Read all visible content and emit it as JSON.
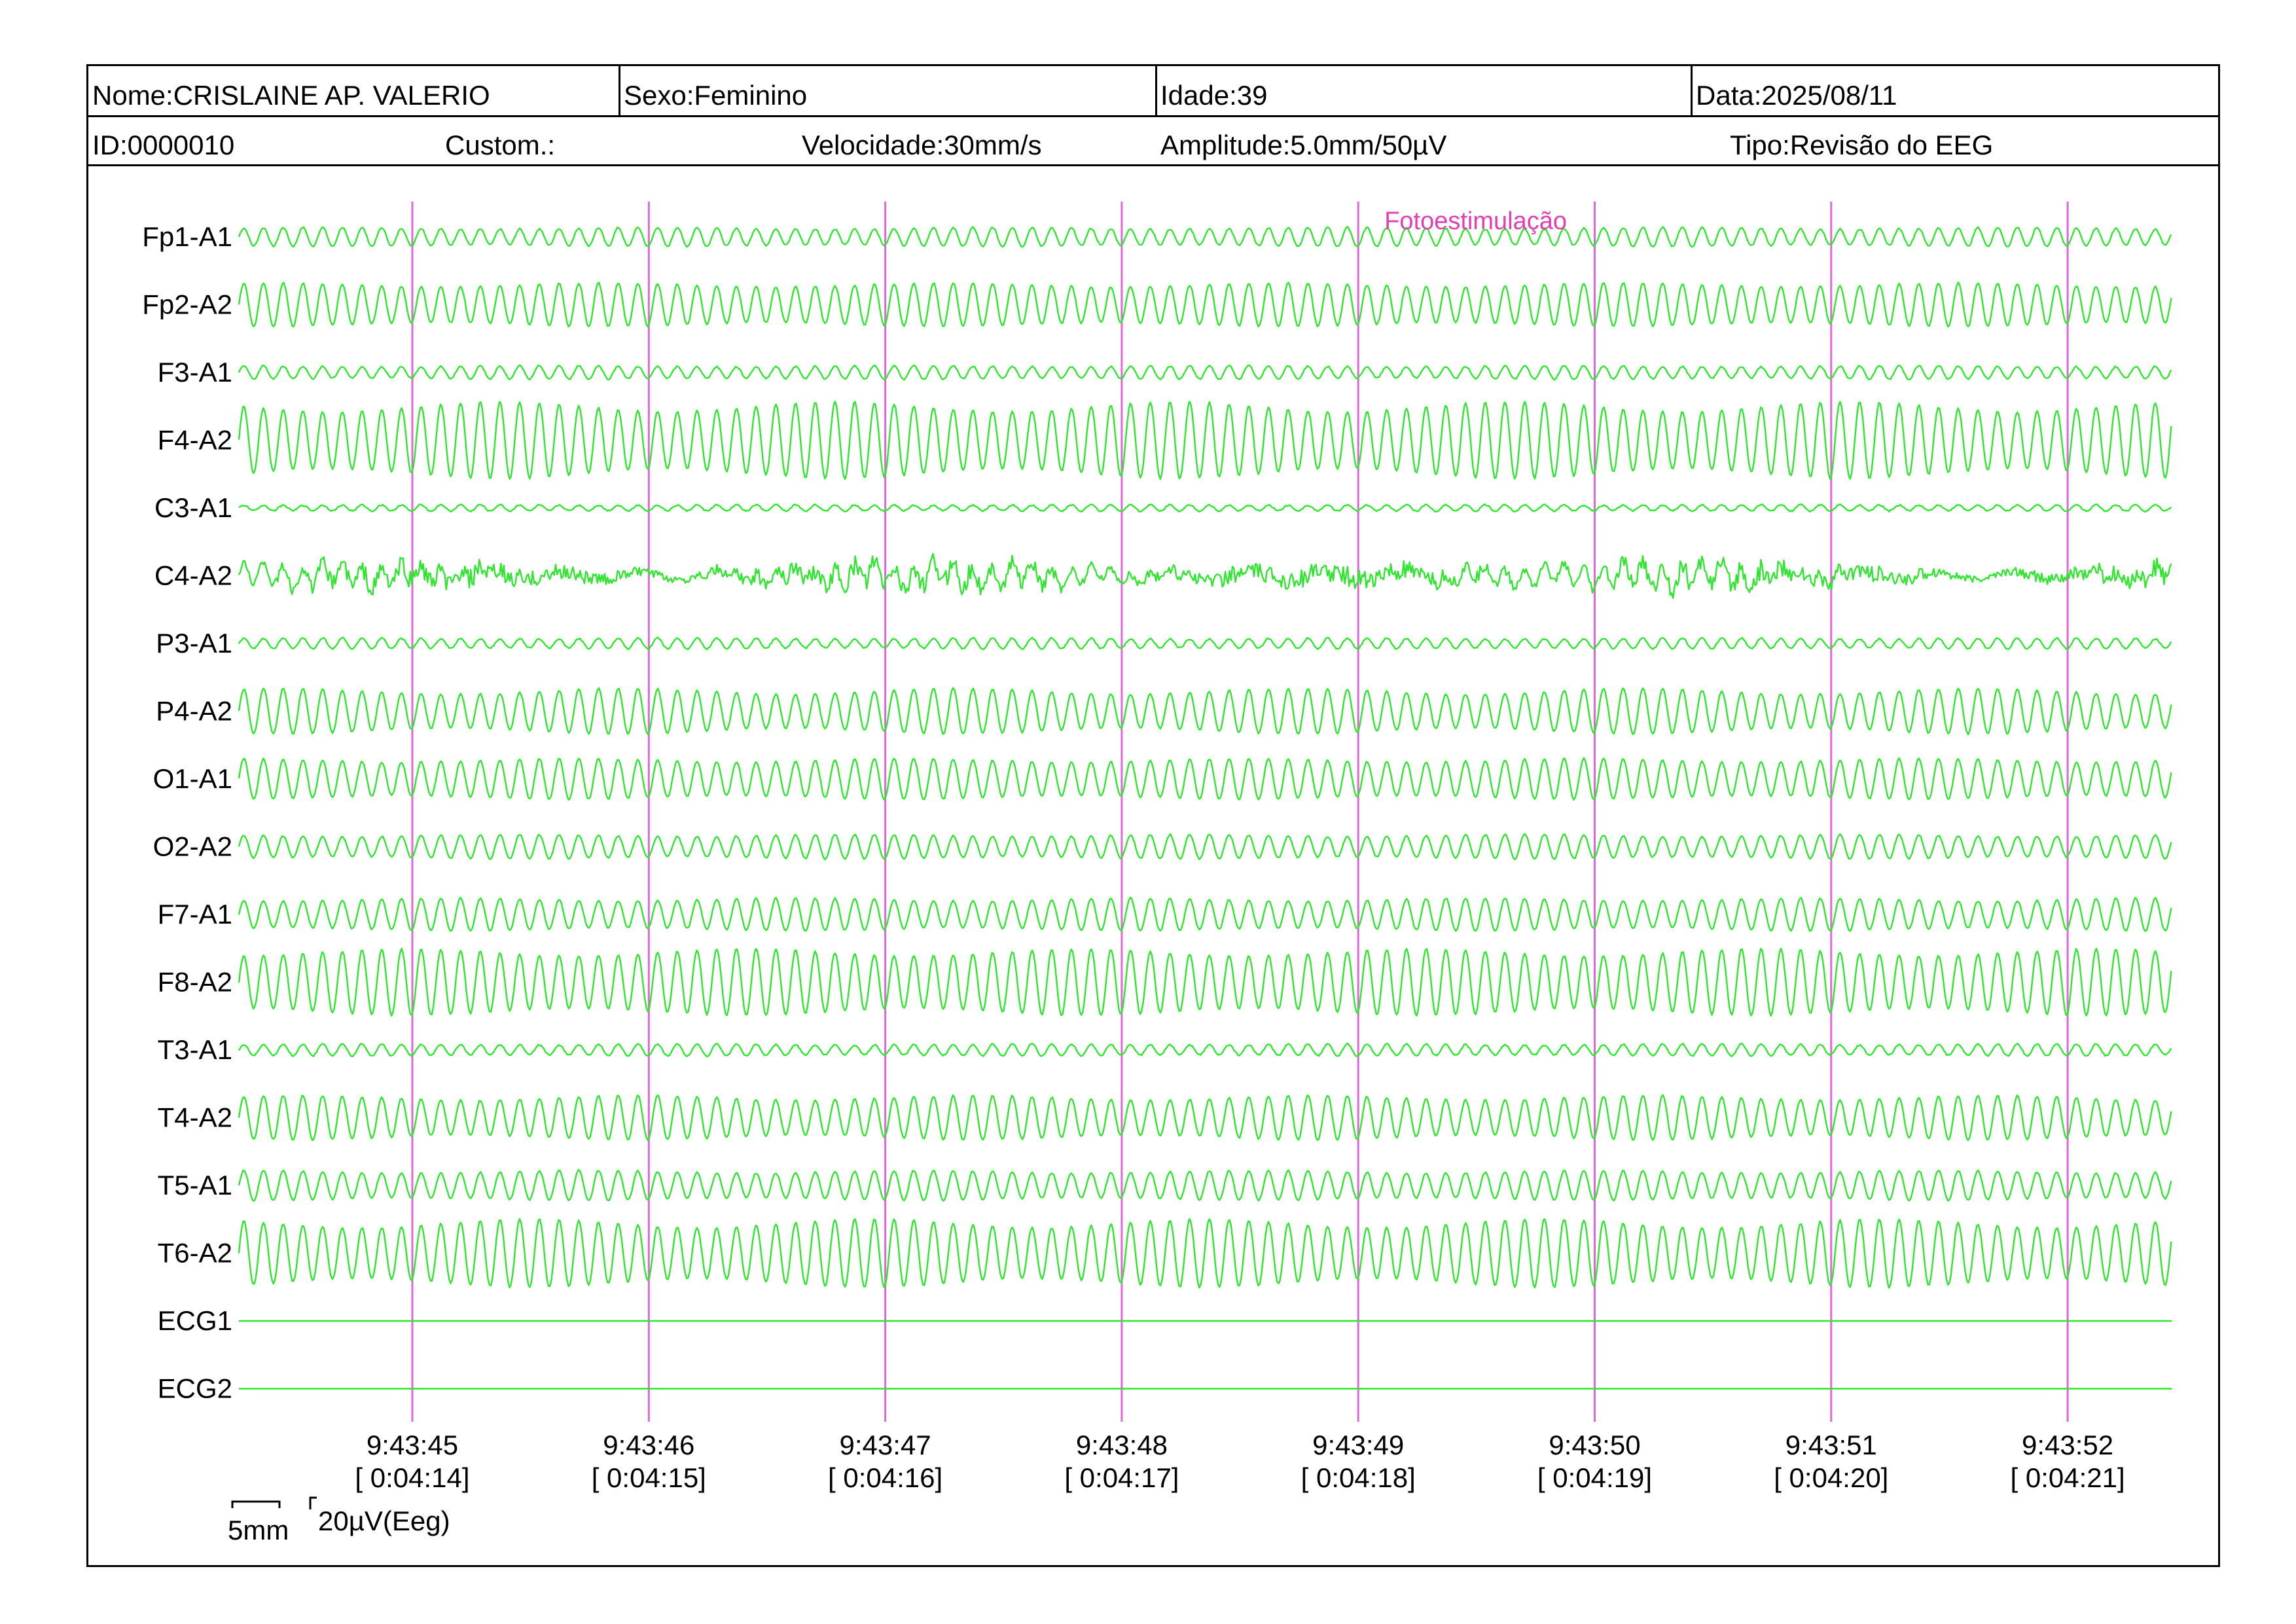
{
  "header": {
    "nome": "Nome:CRISLAINE AP. VALERIO",
    "sexo": "Sexo:Feminino",
    "idade": "Idade:39",
    "data": "Data:2025/08/11",
    "id": "ID:0000010",
    "custom": "Custom.:",
    "velocidade": "Velocidade:30mm/s",
    "amplitude": "Amplitude:5.0mm/50µV",
    "tipo": "Tipo:Revisão do EEG"
  },
  "colors": {
    "trace": "#2ee62e",
    "marker": "#e067d8",
    "annotation": "#e23fb5",
    "border": "#000000"
  },
  "scale": {
    "time_label": "5mm",
    "amp_label": "20µV(Eeg)"
  },
  "chart_data": {
    "type": "line",
    "title": "",
    "xlabel": "",
    "ylabel": "",
    "x_range_seconds": [
      0,
      8.2
    ],
    "grid": false,
    "time_markers": [
      {
        "clock": "9:43:45",
        "elapsed": "[ 0:04:14]"
      },
      {
        "clock": "9:43:46",
        "elapsed": "[ 0:04:15]"
      },
      {
        "clock": "9:43:47",
        "elapsed": "[ 0:04:16]"
      },
      {
        "clock": "9:43:48",
        "elapsed": "[ 0:04:17]"
      },
      {
        "clock": "9:43:49",
        "elapsed": "[ 0:04:18]"
      },
      {
        "clock": "9:43:50",
        "elapsed": "[ 0:04:19]"
      },
      {
        "clock": "9:43:51",
        "elapsed": "[ 0:04:20]"
      },
      {
        "clock": "9:43:52",
        "elapsed": "[ 0:04:21]"
      }
    ],
    "annotations": [
      {
        "text": "Fotoestimulação",
        "at_marker": 5
      }
    ],
    "series": [
      {
        "name": "Fp1-A1",
        "freq_hz": 12,
        "amplitude": 0.35,
        "irregular": 0.1
      },
      {
        "name": "Fp2-A2",
        "freq_hz": 12,
        "amplitude": 0.8,
        "irregular": 0.1
      },
      {
        "name": "F3-A1",
        "freq_hz": 12,
        "amplitude": 0.25,
        "irregular": 0.1
      },
      {
        "name": "F4-A2",
        "freq_hz": 12,
        "amplitude": 1.35,
        "irregular": 0.15
      },
      {
        "name": "C3-A1",
        "freq_hz": 12,
        "amplitude": 0.12,
        "irregular": 0.1
      },
      {
        "name": "C4-A2",
        "freq_hz": 12,
        "amplitude": 0.45,
        "irregular": 1.0
      },
      {
        "name": "P3-A1",
        "freq_hz": 12,
        "amplitude": 0.2,
        "irregular": 0.1
      },
      {
        "name": "P4-A2",
        "freq_hz": 12,
        "amplitude": 0.8,
        "irregular": 0.15
      },
      {
        "name": "O1-A1",
        "freq_hz": 12,
        "amplitude": 0.75,
        "irregular": 0.1
      },
      {
        "name": "O2-A2",
        "freq_hz": 12,
        "amplitude": 0.45,
        "irregular": 0.1
      },
      {
        "name": "F7-A1",
        "freq_hz": 12,
        "amplitude": 0.6,
        "irregular": 0.1
      },
      {
        "name": "F8-A2",
        "freq_hz": 12,
        "amplitude": 1.2,
        "irregular": 0.12
      },
      {
        "name": "T3-A1",
        "freq_hz": 12,
        "amplitude": 0.22,
        "irregular": 0.1
      },
      {
        "name": "T4-A2",
        "freq_hz": 12,
        "amplitude": 0.8,
        "irregular": 0.12
      },
      {
        "name": "T5-A1",
        "freq_hz": 12,
        "amplitude": 0.55,
        "irregular": 0.1
      },
      {
        "name": "T6-A2",
        "freq_hz": 12,
        "amplitude": 1.2,
        "irregular": 0.15
      },
      {
        "name": "ECG1",
        "freq_hz": 0,
        "amplitude": 0,
        "irregular": 0
      },
      {
        "name": "ECG2",
        "freq_hz": 0,
        "amplitude": 0,
        "irregular": 0
      }
    ]
  }
}
